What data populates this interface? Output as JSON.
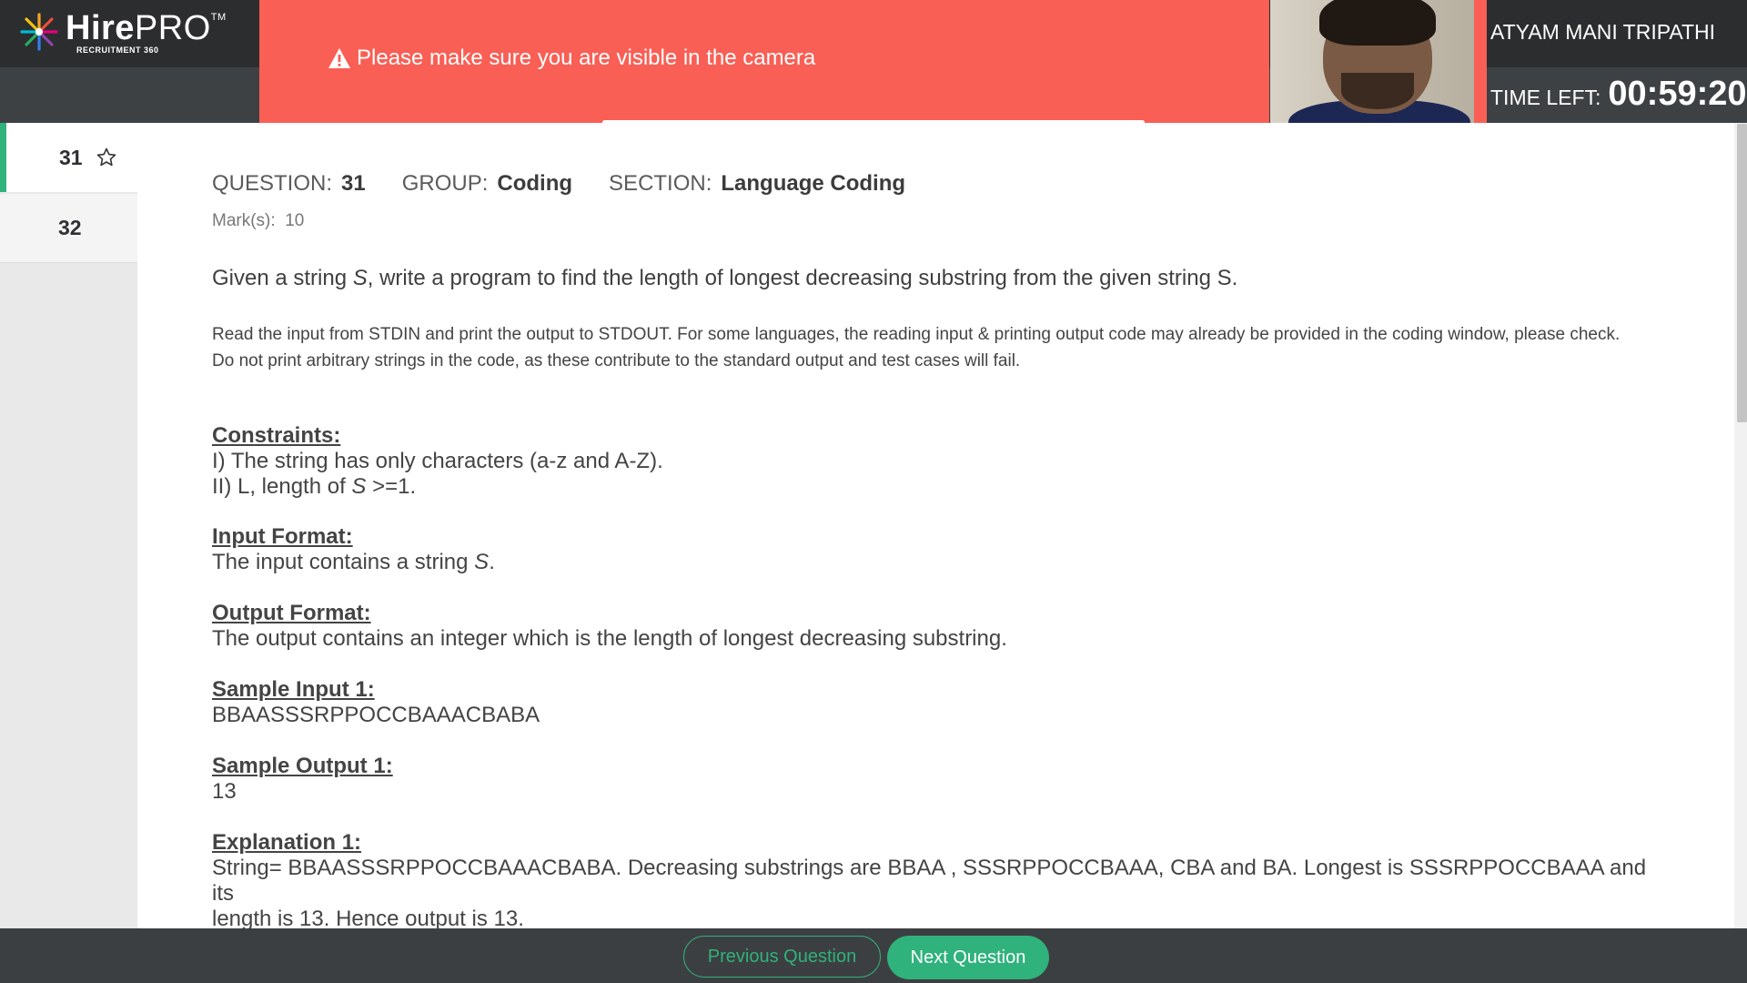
{
  "brand": {
    "logo_name": "HirePRO",
    "logo_bold": "Hire",
    "logo_light": "PRO",
    "trademark": "TM",
    "tagline": "RECRUITMENT 360"
  },
  "alert": {
    "icon": "warning-triangle-icon",
    "message": "Please make sure you are visible in the camera",
    "color": "#f95f55"
  },
  "candidate": {
    "name": "ATYAM MANI TRIPATHI"
  },
  "timer": {
    "label": "TIME LEFT:",
    "value": "00:59:20"
  },
  "sidebar": {
    "items": [
      {
        "number": "31",
        "active": true,
        "starred_icon": "star-outline-icon"
      },
      {
        "number": "32",
        "active": false
      }
    ],
    "accent": "#2fb27c"
  },
  "question": {
    "question_label": "QUESTION:",
    "question_number": "31",
    "group_label": "GROUP:",
    "group_value": "Coding",
    "section_label": "SECTION:",
    "section_value": "Language Coding",
    "marks_label": "Mark(s):",
    "marks_value": "10",
    "title_pre": "Given a string ",
    "title_var": "S",
    "title_post": ", write a program to find the length of longest decreasing substring from the given string S.",
    "instructions_line1": "Read the input from STDIN and print the output to STDOUT. For some languages, the reading input & printing output code may already be provided in the coding window, please check.",
    "instructions_line2": "Do not print arbitrary strings in the code, as these contribute to the standard output and test cases will fail.",
    "constraints_heading": "Constraints:",
    "constraint_1": "I) The string has only characters (a-z and A-Z).",
    "constraint_2_pre": "II) L, length of ",
    "constraint_2_var": "S",
    "constraint_2_post": " >=1.",
    "input_heading": "Input Format:",
    "input_pre": "The input contains a string ",
    "input_var": "S",
    "input_post": ".",
    "output_heading": "Output Format:",
    "output_body": "The output contains an integer which is the length of longest decreasing substring.",
    "sample_input_heading": "Sample Input 1:",
    "sample_input_body": "BBAASSSRPPOCCBAAACBABA",
    "sample_output_heading": "Sample Output 1:",
    "sample_output_body": "13",
    "explanation_heading": "Explanation 1:",
    "explanation_line1": "String= BBAASSSRPPOCCBAAACBABA. Decreasing substrings are BBAA , SSSRPPOCCBAAA, CBA and BA. Longest is  SSSRPPOCCBAAA and its",
    "explanation_line2": "length is 13. Hence output is 13."
  },
  "footer": {
    "previous_label": "Previous Question",
    "next_label": "Next Question"
  }
}
